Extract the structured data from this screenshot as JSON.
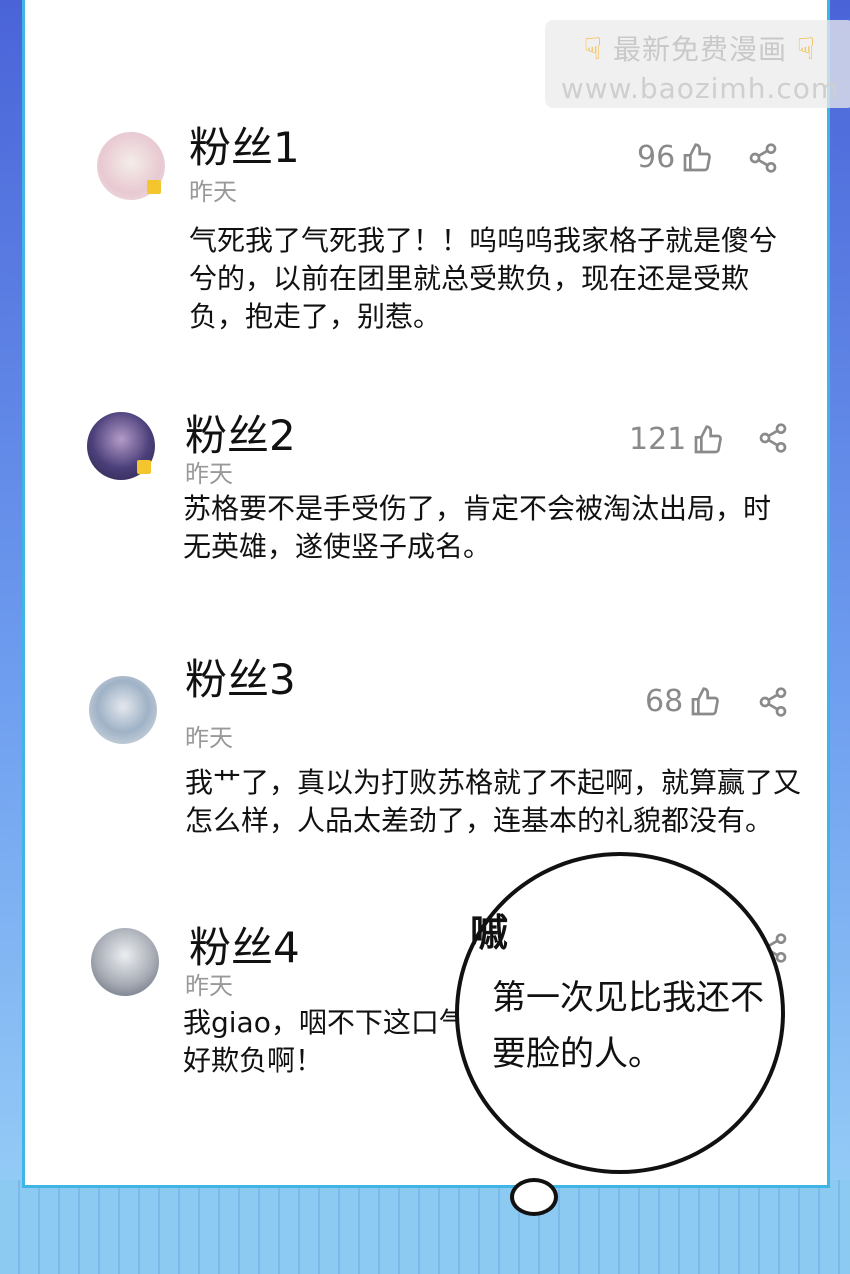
{
  "watermark": {
    "line1": "最新免费漫画",
    "line2": "www.baozimh.com",
    "hand_icon": "pointing-hand-icon"
  },
  "comments": [
    {
      "user": "粉丝1",
      "time": "昨天",
      "likes": "96",
      "text": "气死我了气死我了！！呜呜呜我家格子就是傻兮兮的，以前在团里就总受欺负，现在还是受欺负，抱走了，别惹。",
      "avatar_color": "#e9d6dc"
    },
    {
      "user": "粉丝2",
      "time": "昨天",
      "likes": "121",
      "text": "苏格要不是手受伤了，肯定不会被淘汰出局，时无英雄，遂使竖子成名。",
      "avatar_color": "#55508a"
    },
    {
      "user": "粉丝3",
      "time": "昨天",
      "likes": "68",
      "text": "我艹了，真以为打败苏格就了不起啊，就算赢了又怎么样，人品太差劲了，连基本的礼貌都没有。",
      "avatar_color": "#c9d3dd"
    },
    {
      "user": "粉丝4",
      "time": "昨天",
      "likes": "",
      "text": "我giao，咽不下这口气好欺负啊！",
      "avatar_color": "#b9bcc4"
    }
  ],
  "bubble": {
    "sfx": "嘁",
    "text": "第一次见比我还不要脸的人。"
  },
  "colors": {
    "panel_border": "#3fb5e6",
    "badge": "#f3c630"
  }
}
